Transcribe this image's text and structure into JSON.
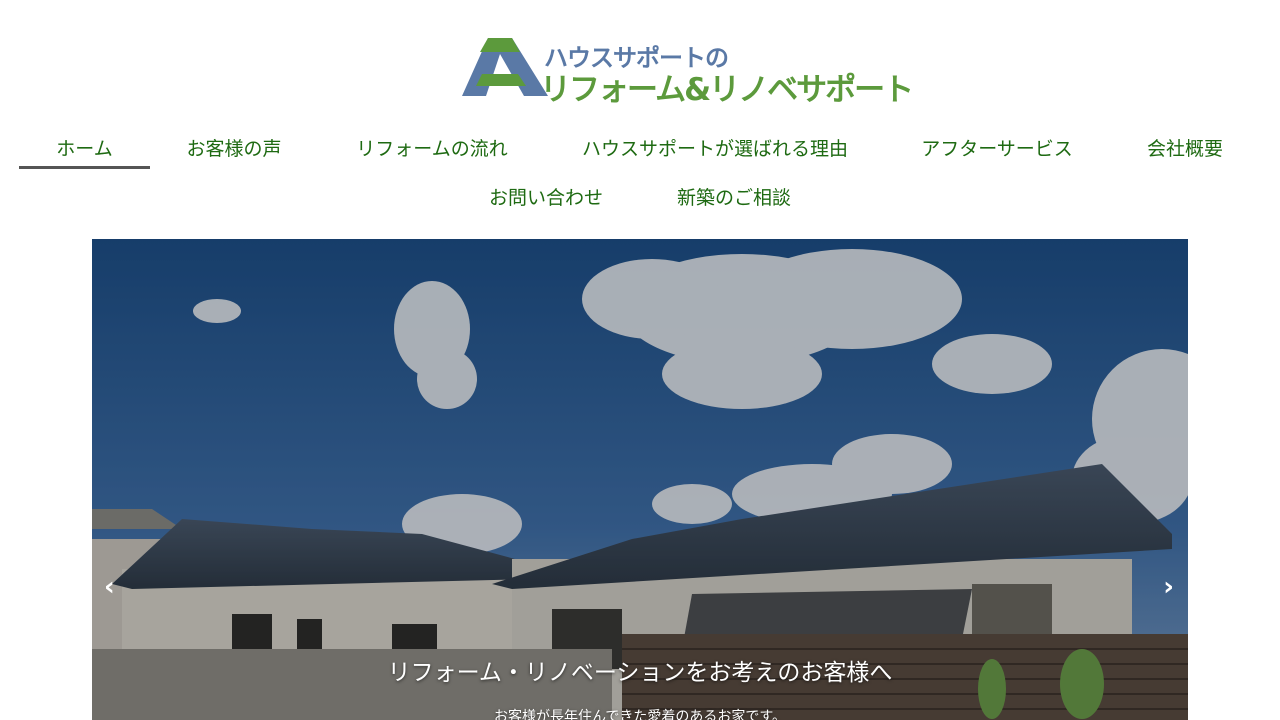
{
  "header": {
    "logo_line1": "ハウスサポートの",
    "logo_line2": "リフォーム&リノベサポート",
    "logo_colors": {
      "blue": "#5a79a6",
      "green": "#5c9a3c"
    }
  },
  "nav": {
    "row1": [
      {
        "label": "ホーム",
        "active": true
      },
      {
        "label": "お客様の声"
      },
      {
        "label": "リフォームの流れ"
      },
      {
        "label": "ハウスサポートが選ばれる理由"
      },
      {
        "label": "アフターサービス"
      },
      {
        "label": "会社概要"
      }
    ],
    "row2": [
      {
        "label": "お問い合わせ"
      },
      {
        "label": "新築のご相談"
      }
    ],
    "link_color": "#1e6a12",
    "active_bar_color": "#555555"
  },
  "hero": {
    "prev_icon": "‹",
    "next_icon": "›",
    "title": "リフォーム・リノベーションをお考えのお客様へ",
    "text": "お客様が長年住んできた愛着のあるお家です。"
  }
}
